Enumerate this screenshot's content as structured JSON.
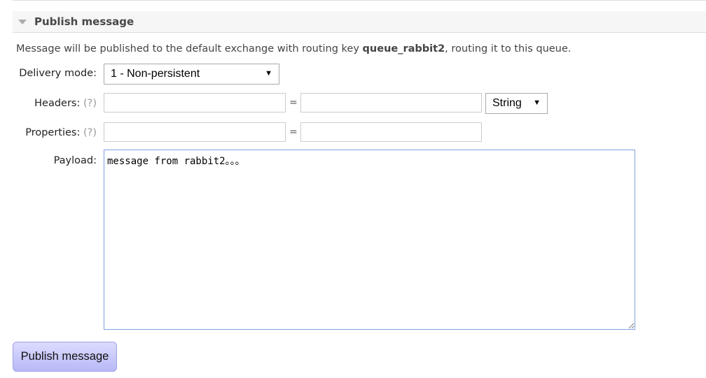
{
  "section": {
    "title": "Publish message"
  },
  "description": {
    "prefix": "Message will be published to the default exchange with routing key ",
    "routing_key": "queue_rabbit2",
    "suffix": ", routing it to this queue."
  },
  "delivery_mode": {
    "label": "Delivery mode:",
    "value": "1 - Non-persistent"
  },
  "headers": {
    "label": "Headers:",
    "help": "(?)",
    "key": "",
    "value": "",
    "eq": "=",
    "type": "String"
  },
  "properties": {
    "label": "Properties:",
    "help": "(?)",
    "key": "",
    "value": "",
    "eq": "="
  },
  "payload": {
    "label": "Payload:",
    "value": "message from rabbit2。。。"
  },
  "publish_button": {
    "label": "Publish message"
  }
}
